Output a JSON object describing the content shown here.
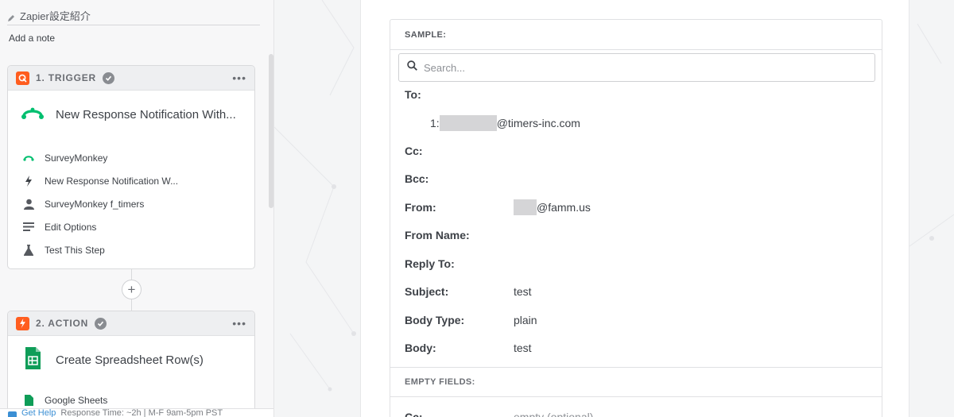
{
  "sidebar": {
    "zap_title": "Zapier設定紹介",
    "add_note": "Add a note",
    "trigger": {
      "label": "1. TRIGGER",
      "app_title": "New Response Notification With...",
      "items": [
        {
          "icon": "surveymonkey-icon",
          "label": "SurveyMonkey"
        },
        {
          "icon": "lightning-icon",
          "label": "New Response Notification W..."
        },
        {
          "icon": "user-icon",
          "label": "SurveyMonkey f_timers"
        },
        {
          "icon": "list-icon",
          "label": "Edit Options"
        },
        {
          "icon": "flask-icon",
          "label": "Test This Step"
        }
      ]
    },
    "action": {
      "label": "2. ACTION",
      "app_title": "Create Spreadsheet Row(s)",
      "items": [
        {
          "icon": "google-sheets-icon",
          "label": "Google Sheets"
        }
      ]
    },
    "footer": {
      "help_label": "Get Help",
      "response_time": "Response Time: ~2h | M-F 9am-5pm PST"
    }
  },
  "sample": {
    "header": "SAMPLE:",
    "search_placeholder": "Search...",
    "fields": {
      "to_label": "To:",
      "to_item_index": "1:",
      "to_item_domain": "@timers-inc.com",
      "cc_label": "Cc:",
      "bcc_label": "Bcc:",
      "from_label": "From:",
      "from_domain": "@famm.us",
      "from_name_label": "From Name:",
      "reply_to_label": "Reply To:",
      "subject_label": "Subject:",
      "subject_value": "test",
      "body_type_label": "Body Type:",
      "body_type_value": "plain",
      "body_label": "Body:",
      "body_value": "test"
    },
    "empty_header": "EMPTY FIELDS:",
    "empty_first_label": "Cc:",
    "empty_first_value": "empty (optional)"
  },
  "colors": {
    "trigger_accent": "#ff5d1f",
    "surveymonkey": "#00bf6f",
    "sheets": "#0f9d58",
    "link": "#3b8fd4"
  }
}
